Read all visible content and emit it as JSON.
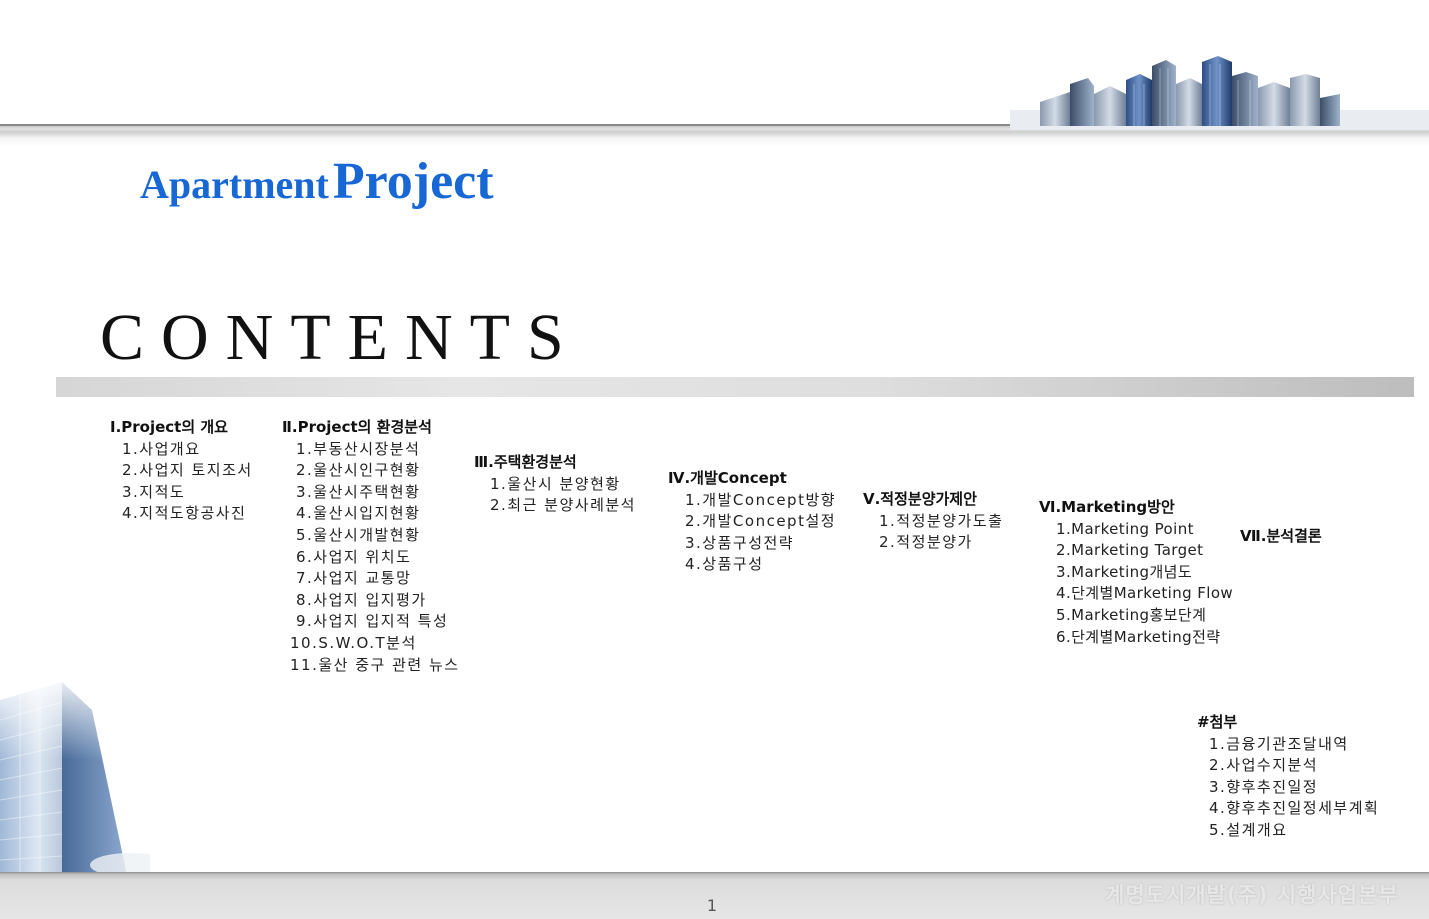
{
  "title": {
    "word1": "Apartment",
    "word2": "Project"
  },
  "heading": "CONTENTS",
  "sections": [
    {
      "title": "Ⅰ.Project의 개요",
      "items": [
        "1.사업개요",
        "2.사업지 토지조서",
        "3.지적도",
        "4.지적도항공사진"
      ]
    },
    {
      "title": "Ⅱ.Project의 환경분석",
      "items": [
        "1.부동산시장분석",
        "2.울산시인구현황",
        "3.울산시주택현황",
        "4.울산시입지현황",
        "5.울산시개발현황",
        "6.사업지 위치도",
        "7.사업지 교통망",
        "8.사업지 입지평가",
        "9.사업지 입지적 특성",
        "10.S.W.O.T분석",
        "11.울산 중구 관련 뉴스"
      ]
    },
    {
      "title": "Ⅲ.주택환경분석",
      "items": [
        "1.울산시 분양현황",
        "2.최근 분양사례분석"
      ]
    },
    {
      "title": "Ⅳ.개발Concept",
      "items": [
        "1.개발Concept방향",
        "2.개발Concept설정",
        "3.상품구성전략",
        "4.상품구성"
      ]
    },
    {
      "title": "Ⅴ.적정분양가제안",
      "items": [
        "1.적정분양가도출",
        "2.적정분양가"
      ]
    },
    {
      "title": "Ⅵ.Marketing방안",
      "items": [
        "1.Marketing Point",
        "2.Marketing Target",
        "3.Marketing개념도",
        "4.단계별Marketing Flow",
        "5.Marketing홍보단계",
        "6.단계별Marketing전략"
      ]
    },
    {
      "title": "Ⅶ.분석결론",
      "items": []
    },
    {
      "title": "#첨부",
      "items": [
        "1.금융기관조달내역",
        "2.사업수지분석",
        "3.향후추진일정",
        "4.향후추진일정세부계획",
        "5.설계개요"
      ]
    }
  ],
  "footer": {
    "page_number": "1",
    "company": "계명도시개발(주) 시행사업본부"
  }
}
